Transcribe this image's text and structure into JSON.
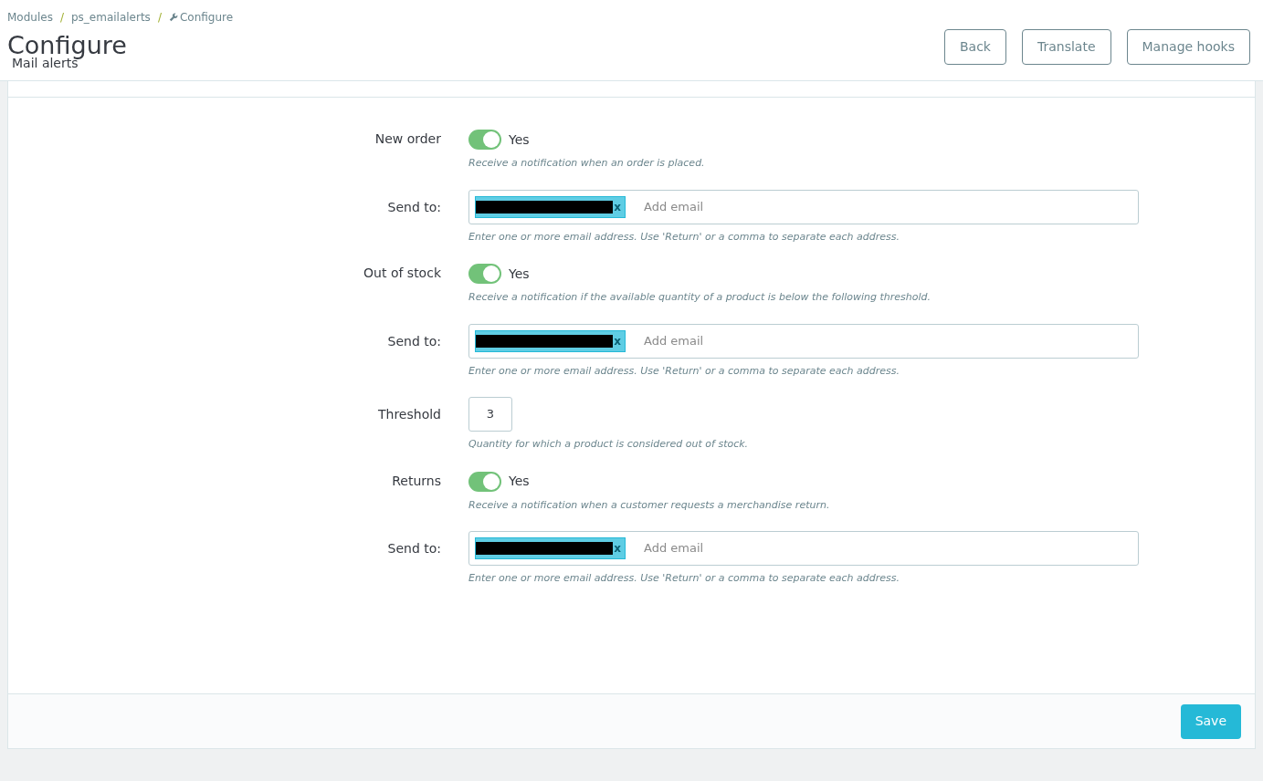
{
  "breadcrumb": [
    "Modules",
    "ps_emailalerts",
    "Configure"
  ],
  "breadcrumb_separator": "/",
  "title": "Configure",
  "subtitle": "Mail alerts",
  "toolbar_buttons": [
    "Back",
    "Translate",
    "Manage hooks"
  ],
  "fields": [
    {
      "kind": "switch",
      "label": "New order",
      "on": true,
      "value_label": "Yes",
      "help": "Receive a notification when an order is placed."
    },
    {
      "kind": "tags",
      "label": "Send to:",
      "tags": [
        {
          "remove": "x"
        }
      ],
      "placeholder": "Add email",
      "help": "Enter one or more email address. Use 'Return' or a comma to separate each address."
    },
    {
      "kind": "switch",
      "label": "Out of stock",
      "on": true,
      "value_label": "Yes",
      "help": "Receive a notification if the available quantity of a product is below the following threshold."
    },
    {
      "kind": "tags",
      "label": "Send to:",
      "tags": [
        {
          "remove": "x"
        }
      ],
      "placeholder": "Add email",
      "help": "Enter one or more email address. Use 'Return' or a comma to separate each address."
    },
    {
      "kind": "number",
      "label": "Threshold",
      "value": "3",
      "help": "Quantity for which a product is considered out of stock."
    },
    {
      "kind": "switch",
      "label": "Returns",
      "on": true,
      "value_label": "Yes",
      "help": "Receive a notification when a customer requests a merchandise return."
    },
    {
      "kind": "tags",
      "label": "Send to:",
      "tags": [
        {
          "remove": "x"
        }
      ],
      "placeholder": "Add email",
      "help": "Enter one or more email address. Use 'Return' or a comma to separate each address."
    }
  ],
  "save_button": "Save"
}
